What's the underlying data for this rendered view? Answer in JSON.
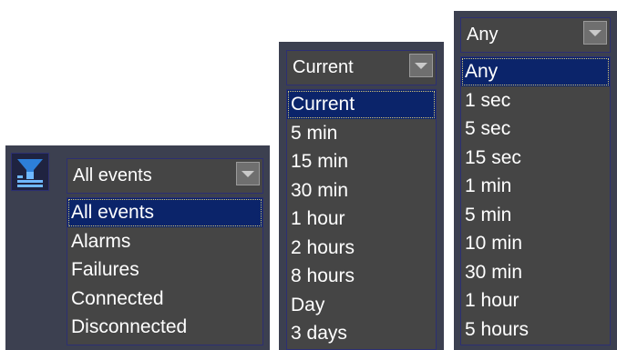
{
  "events_filter": {
    "selected": "All events",
    "options": [
      "All events",
      "Alarms",
      "Failures",
      "Connected",
      "Disconnected"
    ],
    "highlighted_index": 0
  },
  "time_range": {
    "selected": "Current",
    "options": [
      "Current",
      "5 min",
      "15 min",
      "30 min",
      "1 hour",
      "2 hours",
      "8 hours",
      "Day",
      "3 days"
    ],
    "highlighted_index": 0
  },
  "interval": {
    "selected": "Any",
    "options": [
      "Any",
      "1 sec",
      "5 sec",
      "15 sec",
      "1 min",
      "5 min",
      "10 min",
      "30 min",
      "1 hour",
      "5 hours"
    ],
    "highlighted_index": 0
  },
  "icons": {
    "filter": "filter-list-icon",
    "dropdown": "chevron-down-icon"
  },
  "colors": {
    "panel_bg": "#3c4050",
    "list_bg": "#454545",
    "border": "#2c2f72",
    "highlight": "#0b246a",
    "text": "#ffffff"
  }
}
